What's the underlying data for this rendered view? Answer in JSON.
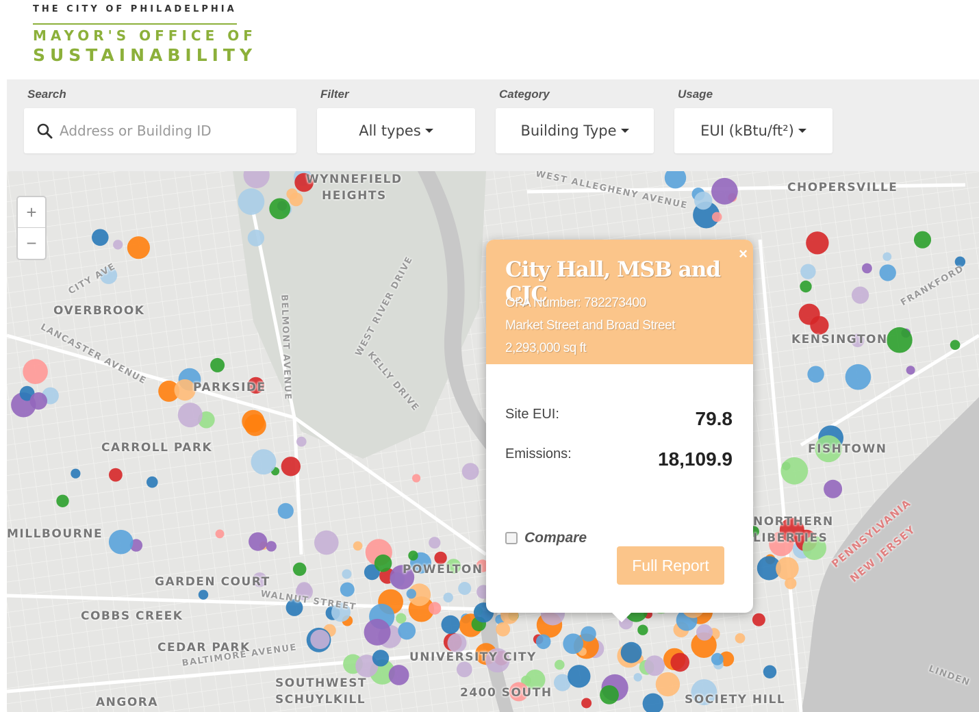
{
  "header": {
    "city_name": "THE CITY OF PHILADELPHIA",
    "office_line1": "MAYOR'S OFFICE OF",
    "office_line2": "SUSTAINABILITY"
  },
  "toolbar": {
    "search": {
      "label": "Search",
      "placeholder": "Address or Building ID",
      "value": ""
    },
    "filter": {
      "label": "Filter",
      "selected": "All types"
    },
    "category": {
      "label": "Category",
      "selected": "Building Type"
    },
    "usage": {
      "label": "Usage",
      "selected": "EUI (kBtu/ft²)"
    }
  },
  "map": {
    "zoom_in": "+",
    "zoom_out": "−",
    "neighborhoods": [
      "WYNNEFIELD",
      "HEIGHTS",
      "CHOPERSVILLE",
      "OVERBROOK",
      "PARKSIDE",
      "CARROLL PARK",
      "MILLBOURNE",
      "GARDEN COURT",
      "COBBS CREEK",
      "CEDAR PARK",
      "SOUTHWEST",
      "SCHUYLKILL",
      "ANGORA",
      "POWELTON",
      "UNIVERSITY CITY",
      "2400 SOUTH",
      "SOCIETY HILL",
      "FISHTOWN",
      "KENSINGTON",
      "NORTHERN LIBERTIES",
      "PENNSYLVANIA",
      "NEW JERSEY"
    ],
    "streets": [
      "CITY AVE",
      "LANCASTER AVENUE",
      "BELMONT AVENUE",
      "WEST RIVER DRIVE",
      "KELLY DRIVE",
      "WEST ALLEGHENY AVENUE",
      "BALTIMORE AVENUE",
      "WALNUT STREET",
      "FRANKFORD",
      "LINDEN"
    ]
  },
  "popup": {
    "close": "×",
    "title": "City Hall, MSB and CJC",
    "opa_number": "OPA Number: 782273400",
    "address": "Market Street and Broad Street",
    "area": "2,293,000 sq ft",
    "site_eui_label": "Site EUI:",
    "site_eui_value": "79.8",
    "emissions_label": "Emissions:",
    "emissions_value": "18,109.9",
    "compare_label": "Compare",
    "full_report_label": "Full Report"
  },
  "colors": {
    "brand_green": "#8cb03a",
    "popup_accent": "#fbc58a",
    "dot_palette": [
      "#2a7ab8",
      "#5aa3da",
      "#a8cde8",
      "#2ca02c",
      "#98df8a",
      "#d62728",
      "#ff9896",
      "#ff7f0e",
      "#ffbb78",
      "#9467bd",
      "#c5b0d5"
    ]
  }
}
